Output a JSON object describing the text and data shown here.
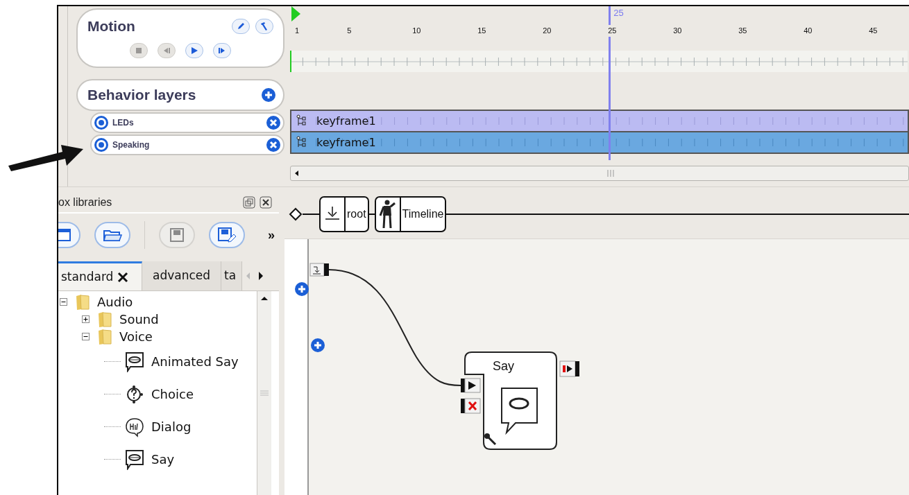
{
  "motion": {
    "title": "Motion",
    "tools": [
      {
        "kind": "edit"
      },
      {
        "kind": "tools"
      }
    ],
    "playback": [
      {
        "kind": "stop",
        "disabled": true
      },
      {
        "kind": "back",
        "disabled": true
      },
      {
        "kind": "play",
        "disabled": false
      },
      {
        "kind": "next",
        "disabled": false
      }
    ]
  },
  "behavior_layers": {
    "title": "Behavior layers",
    "layers": [
      {
        "name": "LEDs",
        "keyframe": "keyframe1",
        "selected": false
      },
      {
        "name": "Speaking",
        "keyframe": "keyframe1",
        "selected": true
      }
    ]
  },
  "timeline": {
    "current_frame": "25",
    "ticks": [
      "1",
      "5",
      "10",
      "15",
      "20",
      "25",
      "30",
      "35",
      "40",
      "45"
    ]
  },
  "breadcrumb": [
    {
      "kind": "root",
      "label": "root"
    },
    {
      "kind": "timeline",
      "label": "Timeline"
    }
  ],
  "library": {
    "title": "ox libraries",
    "toolbar": [
      {
        "kind": "window",
        "disabled": false
      },
      {
        "kind": "open",
        "disabled": false
      },
      {
        "kind": "save",
        "disabled": true
      },
      {
        "kind": "save_as",
        "disabled": false
      }
    ],
    "overflow": "»",
    "tabs": [
      {
        "label": "standard",
        "selected": true,
        "closable": true
      },
      {
        "label": "advanced",
        "selected": false,
        "closable": false
      },
      {
        "label": "ta",
        "selected": false,
        "closable": false
      }
    ],
    "tree": [
      {
        "label": "Audio",
        "kind": "folder",
        "expanded": true,
        "children": [
          {
            "label": "Sound",
            "kind": "folder",
            "expanded": false
          },
          {
            "label": "Voice",
            "kind": "folder",
            "expanded": true,
            "children": [
              {
                "label": "Animated Say",
                "kind": "say"
              },
              {
                "label": "Choice",
                "kind": "choice"
              },
              {
                "label": "Dialog",
                "kind": "dialog"
              },
              {
                "label": "Say",
                "kind": "say"
              }
            ]
          }
        ]
      }
    ]
  },
  "canvas": {
    "box": {
      "title": "Say"
    }
  }
}
